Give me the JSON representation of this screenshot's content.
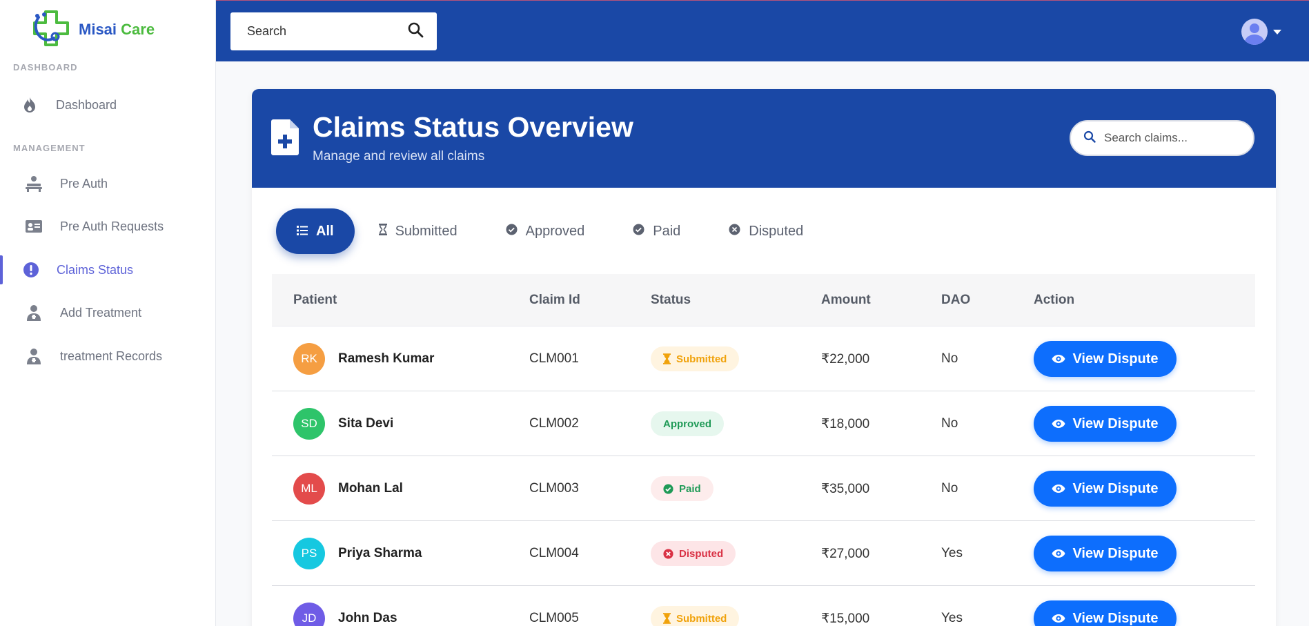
{
  "brand": {
    "name_part1": "Misai",
    "name_part2": "Care"
  },
  "sidebar": {
    "section_dashboard": "DASHBOARD",
    "section_management": "MANAGEMENT",
    "items": [
      {
        "label": "Dashboard",
        "icon": "fire-icon"
      },
      {
        "label": "Pre Auth",
        "icon": "doctor-patient-icon"
      },
      {
        "label": "Pre Auth Requests",
        "icon": "id-card-icon"
      },
      {
        "label": "Claims Status",
        "icon": "exclamation-circle-icon",
        "active": true
      },
      {
        "label": "Add Treatment",
        "icon": "doctor-icon"
      },
      {
        "label": "treatment Records",
        "icon": "doctor-icon"
      }
    ]
  },
  "topbar": {
    "search_placeholder": "Search"
  },
  "header": {
    "title": "Claims Status Overview",
    "subtitle": "Manage and review all claims",
    "search_placeholder": "Search claims..."
  },
  "tabs": [
    {
      "label": "All",
      "icon": "list-icon",
      "active": true
    },
    {
      "label": "Submitted",
      "icon": "hourglass-icon"
    },
    {
      "label": "Approved",
      "icon": "check-circle-icon"
    },
    {
      "label": "Paid",
      "icon": "check-circle-icon"
    },
    {
      "label": "Disputed",
      "icon": "x-circle-icon"
    }
  ],
  "table": {
    "headers": [
      "Patient",
      "Claim Id",
      "Status",
      "Amount",
      "DAO",
      "Action"
    ],
    "rows": [
      {
        "initials": "RK",
        "avatar_color": "#f59e42",
        "name": "Ramesh Kumar",
        "claim_id": "CLM001",
        "status": "Submitted",
        "amount": "₹22,000",
        "dao": "No",
        "action": "View Dispute"
      },
      {
        "initials": "SD",
        "avatar_color": "#2ec46a",
        "name": "Sita Devi",
        "claim_id": "CLM002",
        "status": "Approved",
        "amount": "₹18,000",
        "dao": "No",
        "action": "View Dispute"
      },
      {
        "initials": "ML",
        "avatar_color": "#e34b4b",
        "name": "Mohan Lal",
        "claim_id": "CLM003",
        "status": "Paid",
        "amount": "₹35,000",
        "dao": "No",
        "action": "View Dispute"
      },
      {
        "initials": "PS",
        "avatar_color": "#16c8e0",
        "name": "Priya Sharma",
        "claim_id": "CLM004",
        "status": "Disputed",
        "amount": "₹27,000",
        "dao": "Yes",
        "action": "View Dispute"
      },
      {
        "initials": "JD",
        "avatar_color": "#6f5ce6",
        "name": "John Das",
        "claim_id": "CLM005",
        "status": "Submitted",
        "amount": "₹15,000",
        "dao": "Yes",
        "action": "View Dispute"
      }
    ]
  },
  "colors": {
    "primary": "#1a48a6",
    "button": "#0d6efd",
    "active_nav": "#5d62d8",
    "submitted_bg": "#fff4e0",
    "submitted_fg": "#f0a20b",
    "approved_bg": "#e6f7ee",
    "approved_fg": "#1f9a57",
    "paid_bg": "#fdecec",
    "paid_fg": "#1f9a57",
    "disputed_bg": "#fde5e7",
    "disputed_fg": "#d93245"
  }
}
